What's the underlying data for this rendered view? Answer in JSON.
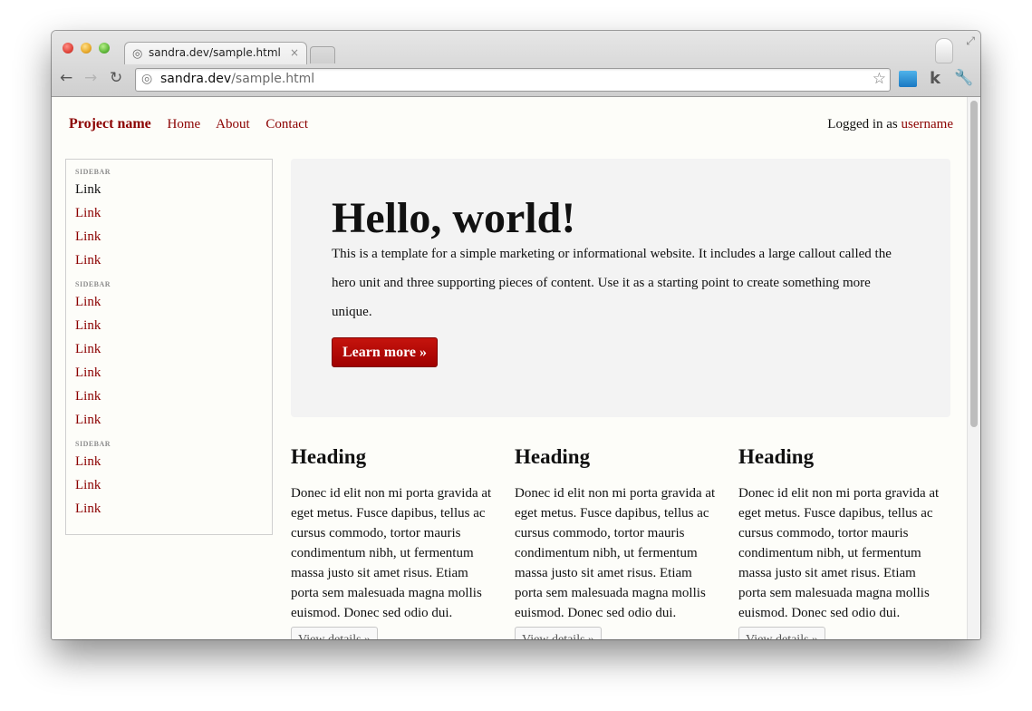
{
  "browser": {
    "tab_title": "sandra.dev/sample.html",
    "tab_close": "×",
    "url_host": "sandra.dev",
    "url_path": "/sample.html",
    "extension_k": "k"
  },
  "page": {
    "brand": "Project name",
    "nav": [
      "Home",
      "About",
      "Contact"
    ],
    "login_prefix": "Logged in as ",
    "login_user": "username",
    "sidebar": [
      {
        "header": "SIDEBAR",
        "links": [
          "Link",
          "Link",
          "Link",
          "Link"
        ]
      },
      {
        "header": "SIDEBAR",
        "links": [
          "Link",
          "Link",
          "Link",
          "Link",
          "Link",
          "Link"
        ]
      },
      {
        "header": "SIDEBAR",
        "links": [
          "Link",
          "Link",
          "Link"
        ]
      }
    ],
    "hero": {
      "title": "Hello, world!",
      "text": "This is a template for a simple marketing or informational website. It includes a large callout called the hero unit and three supporting pieces of content. Use it as a starting point to create something more unique.",
      "button": "Learn more »"
    },
    "columns": [
      {
        "heading": "Heading",
        "text": "Donec id elit non mi porta gravida at eget metus. Fusce dapibus, tellus ac cursus commodo, tortor mauris condimentum nibh, ut fermentum massa justo sit amet risus. Etiam porta sem malesuada magna mollis euismod. Donec sed odio dui.",
        "button": "View details »"
      },
      {
        "heading": "Heading",
        "text": "Donec id elit non mi porta gravida at eget metus. Fusce dapibus, tellus ac cursus commodo, tortor mauris condimentum nibh, ut fermentum massa justo sit amet risus. Etiam porta sem malesuada magna mollis euismod. Donec sed odio dui.",
        "button": "View details »"
      },
      {
        "heading": "Heading",
        "text": "Donec id elit non mi porta gravida at eget metus. Fusce dapibus, tellus ac cursus commodo, tortor mauris condimentum nibh, ut fermentum massa justo sit amet risus. Etiam porta sem malesuada magna mollis euismod. Donec sed odio dui.",
        "button": "View details »"
      }
    ]
  },
  "colors": {
    "link": "#8b0000",
    "button": "#b00a06"
  }
}
